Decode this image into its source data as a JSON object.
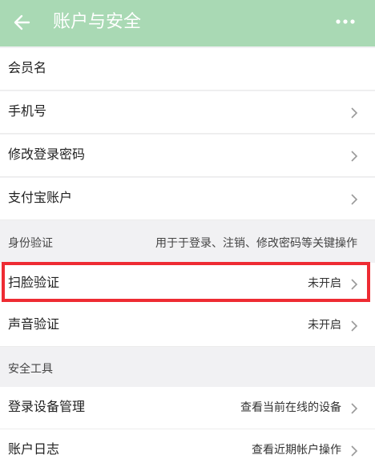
{
  "header": {
    "title": "账户与安全",
    "back_icon": "back-arrow-icon",
    "more_icon": "more-dots-icon"
  },
  "rows": {
    "member_name": {
      "label": "会员名"
    },
    "phone": {
      "label": "手机号"
    },
    "change_password": {
      "label": "修改登录密码"
    },
    "alipay": {
      "label": "支付宝账户"
    },
    "face_verify": {
      "label": "扫脸验证",
      "value": "未开启"
    },
    "voice_verify": {
      "label": "声音验证",
      "value": "未开启"
    },
    "device_mgmt": {
      "label": "登录设备管理",
      "value": "查看当前在线的设备"
    },
    "account_log": {
      "label": "账户日志",
      "value": "查看近期帐户操作"
    }
  },
  "sections": {
    "identity": {
      "title": "身份验证",
      "note": "用于于登录、注销、修改密码等关键操作"
    },
    "security_tools": {
      "title": "安全工具"
    }
  },
  "colors": {
    "header_bg": "#a9d9b4",
    "highlight": "#ee2b33",
    "background": "#f1f1f3"
  }
}
